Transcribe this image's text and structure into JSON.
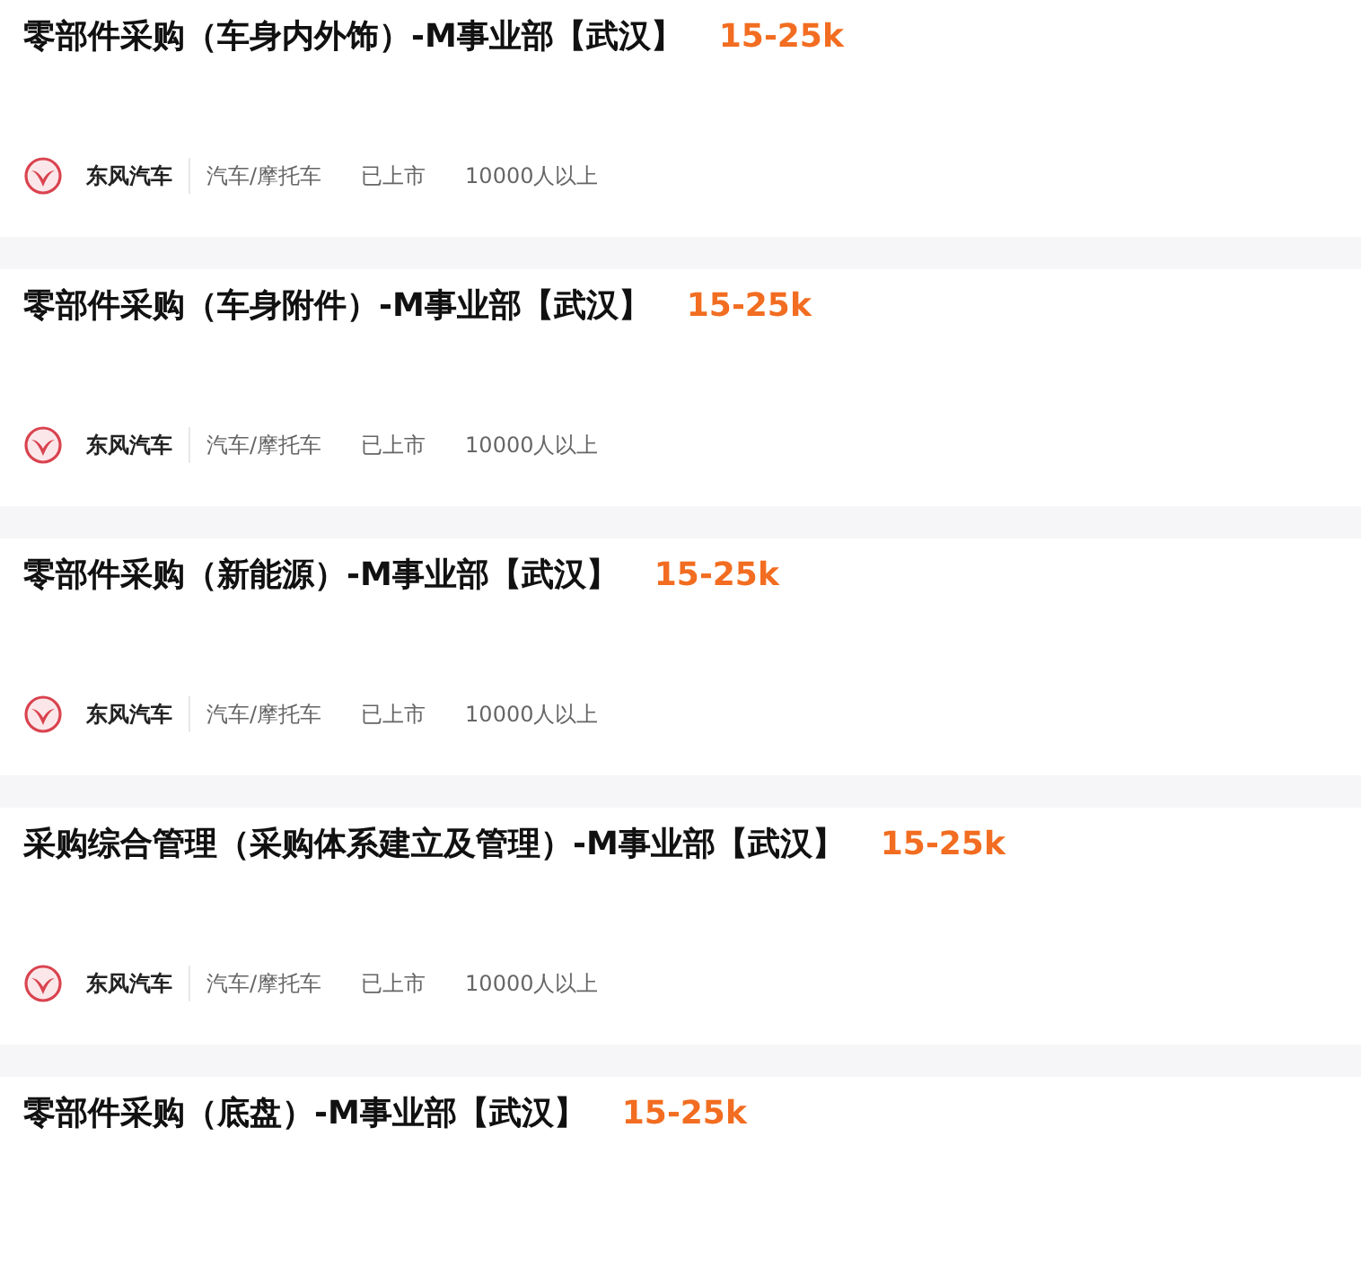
{
  "jobs": [
    {
      "title": "零部件采购（车身内外饰）-M事业部【武汉】",
      "salary": "15-25k",
      "company": "东风汽车",
      "tags": [
        "汽车/摩托车",
        "已上市",
        "10000人以上"
      ]
    },
    {
      "title": "零部件采购（车身附件）-M事业部【武汉】",
      "salary": "15-25k",
      "company": "东风汽车",
      "tags": [
        "汽车/摩托车",
        "已上市",
        "10000人以上"
      ]
    },
    {
      "title": "零部件采购（新能源）-M事业部【武汉】",
      "salary": "15-25k",
      "company": "东风汽车",
      "tags": [
        "汽车/摩托车",
        "已上市",
        "10000人以上"
      ]
    },
    {
      "title": "采购综合管理（采购体系建立及管理）-M事业部【武汉】",
      "salary": "15-25k",
      "company": "东风汽车",
      "tags": [
        "汽车/摩托车",
        "已上市",
        "10000人以上"
      ]
    },
    {
      "title": "零部件采购（底盘）-M事业部【武汉】",
      "salary": "15-25k"
    }
  ]
}
